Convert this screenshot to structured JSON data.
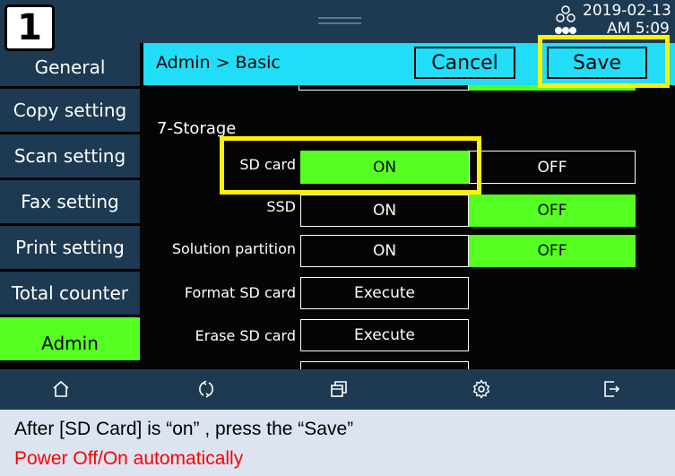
{
  "step_badge": "1",
  "status": {
    "date": "2019-02-13",
    "time": "AM 5:09"
  },
  "sidebar": {
    "items": [
      {
        "label": "General"
      },
      {
        "label": "Copy setting"
      },
      {
        "label": "Scan setting"
      },
      {
        "label": "Fax setting"
      },
      {
        "label": "Print setting"
      },
      {
        "label": "Total counter"
      },
      {
        "label": "Admin",
        "active": true
      }
    ]
  },
  "header": {
    "breadcrumb": "Admin > Basic",
    "cancel_label": "Cancel",
    "save_label": "Save"
  },
  "content": {
    "section_title": "7-Storage",
    "rows": [
      {
        "label": "SD card",
        "on": "ON",
        "off": "OFF",
        "selected": "ON"
      },
      {
        "label": "SSD",
        "on": "ON",
        "off": "OFF",
        "selected": "OFF"
      },
      {
        "label": "Solution partition",
        "on": "ON",
        "off": "OFF",
        "selected": "OFF"
      },
      {
        "label": "Format SD card",
        "action": "Execute"
      },
      {
        "label": "Erase SD card",
        "action": "Execute"
      }
    ]
  },
  "toolbar": {
    "icons": [
      "home-icon",
      "refresh-icon",
      "windows-icon",
      "settings-icon",
      "logout-icon"
    ]
  },
  "colors": {
    "accent_cyan": "#21ddf7",
    "selected_green": "#55ff22",
    "highlight_yellow": "#fff200",
    "warning_red": "#ff0000"
  },
  "captions": {
    "instruction": "After [SD Card] is “on” , press the “Save”",
    "warning": "Power Off/On automatically"
  }
}
